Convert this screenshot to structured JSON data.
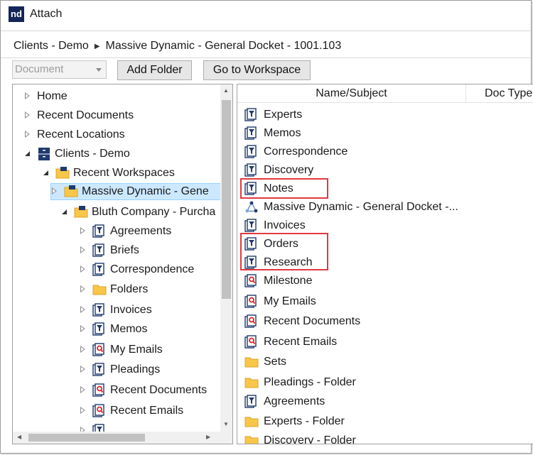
{
  "window": {
    "app_icon_text": "nd",
    "title": "Attach"
  },
  "breadcrumb": {
    "items": [
      "Clients - Demo",
      "Massive Dynamic - General Docket - 1001.103"
    ]
  },
  "toolbar": {
    "dropdown_value": "Document",
    "add_folder_label": "Add Folder",
    "go_to_workspace_label": "Go to Workspace"
  },
  "tree": {
    "home": "Home",
    "recent_documents": "Recent Documents",
    "recent_locations": "Recent Locations",
    "clients_demo": "Clients - Demo",
    "recent_workspaces": "Recent Workspaces",
    "massive_dynamic": "Massive Dynamic - Gene",
    "bluth_company": "Bluth Company - Purcha",
    "bluth_children": [
      {
        "label": "Agreements",
        "icon": "filter-folder-icon"
      },
      {
        "label": "Briefs",
        "icon": "filter-folder-icon"
      },
      {
        "label": "Correspondence",
        "icon": "filter-folder-icon"
      },
      {
        "label": "Folders",
        "icon": "folder-icon"
      },
      {
        "label": "Invoices",
        "icon": "filter-folder-icon"
      },
      {
        "label": "Memos",
        "icon": "filter-folder-icon"
      },
      {
        "label": "My Emails",
        "icon": "search-folder-icon"
      },
      {
        "label": "Pleadings",
        "icon": "filter-folder-icon"
      },
      {
        "label": "Recent Documents",
        "icon": "search-folder-icon"
      },
      {
        "label": "Recent Emails",
        "icon": "search-folder-icon"
      }
    ]
  },
  "list": {
    "columns": {
      "name": "Name/Subject",
      "type": "Doc Type"
    },
    "items": [
      {
        "label": "Experts",
        "icon": "filter-folder-icon"
      },
      {
        "label": "Memos",
        "icon": "filter-folder-icon"
      },
      {
        "label": "Correspondence",
        "icon": "filter-folder-icon"
      },
      {
        "label": "Discovery",
        "icon": "filter-folder-icon"
      },
      {
        "label": "Notes",
        "icon": "filter-folder-icon"
      },
      {
        "label": "Massive Dynamic - General Docket -...",
        "icon": "workspace-icon"
      },
      {
        "label": "Invoices",
        "icon": "filter-folder-icon"
      },
      {
        "label": "Orders",
        "icon": "filter-folder-icon"
      },
      {
        "label": "Research",
        "icon": "filter-folder-icon"
      },
      {
        "label": "Milestone",
        "icon": "search-folder-icon"
      },
      {
        "label": "My Emails",
        "icon": "search-folder-icon"
      },
      {
        "label": "Recent Documents",
        "icon": "search-folder-icon"
      },
      {
        "label": "Recent Emails",
        "icon": "search-folder-icon"
      },
      {
        "label": "Sets",
        "icon": "folder-icon"
      },
      {
        "label": "Pleadings - Folder",
        "icon": "folder-icon"
      },
      {
        "label": "Agreements",
        "icon": "filter-folder-icon"
      },
      {
        "label": "Experts - Folder",
        "icon": "folder-icon"
      },
      {
        "label": "Discovery - Folder",
        "icon": "folder-icon"
      }
    ]
  },
  "colors": {
    "selection": "#cce8ff",
    "highlight": "#e0393e",
    "folder": "#f8c648",
    "cabinet": "#1f3a6e"
  }
}
